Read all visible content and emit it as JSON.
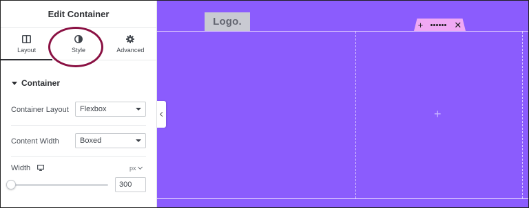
{
  "panel": {
    "title": "Edit Container",
    "tabs": [
      {
        "label": "Layout",
        "icon": "layout-icon",
        "active": true
      },
      {
        "label": "Style",
        "icon": "half-circle-icon",
        "active": false
      },
      {
        "label": "Advanced",
        "icon": "gear-icon",
        "active": false
      }
    ],
    "section": {
      "title": "Container",
      "expanded": true
    },
    "container_layout": {
      "label": "Container Layout",
      "value": "Flexbox"
    },
    "content_width": {
      "label": "Content Width",
      "value": "Boxed"
    },
    "width": {
      "label": "Width",
      "device_icon": "desktop-icon",
      "unit": "px",
      "value": "300",
      "slider_fraction": 0.05
    }
  },
  "canvas": {
    "logo_text": "Logo.",
    "handle": {
      "add_icon": "plus-icon",
      "drag_icon": "drag-dots-icon",
      "close_icon": "close-icon"
    },
    "add_element_icon": "plus-icon",
    "colors": {
      "background": "#8b5cfd",
      "handle": "#f0a9f4",
      "highlight": "#8a1143"
    }
  }
}
